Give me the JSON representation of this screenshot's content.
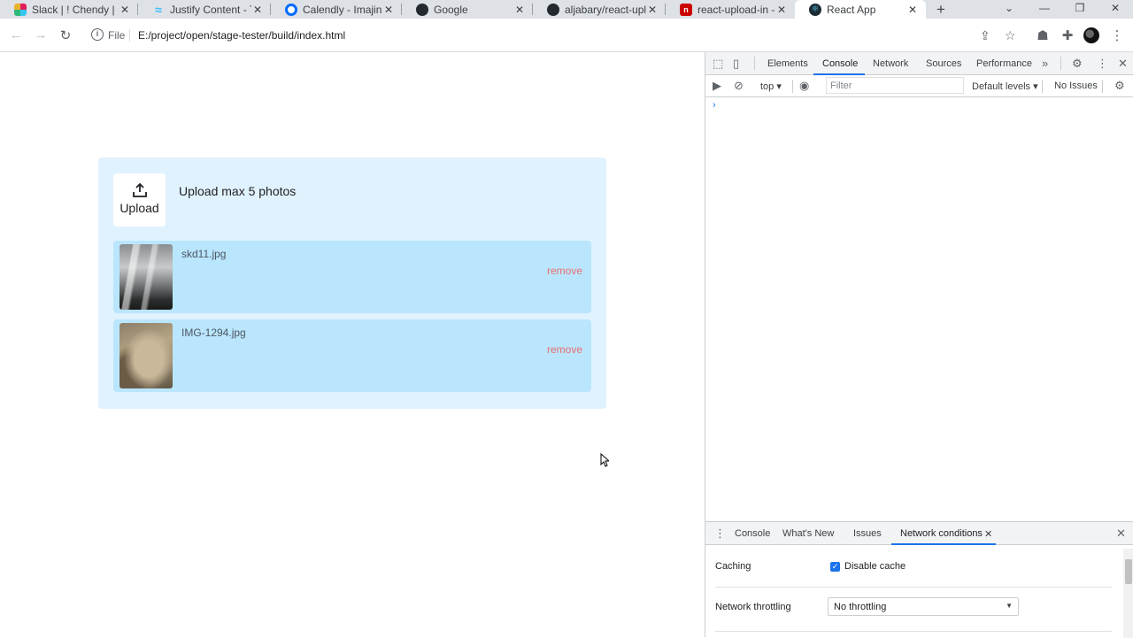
{
  "tabs": [
    {
      "title": "Slack | ! Chendy | Im",
      "icon": "slack-icon"
    },
    {
      "title": "Justify Content - Tail",
      "icon": "tailwind-icon"
    },
    {
      "title": "Calendly - Imajin HR",
      "icon": "calendly-icon"
    },
    {
      "title": "Google",
      "icon": "github-icon"
    },
    {
      "title": "aljabary/react-uploa",
      "icon": "github-icon"
    },
    {
      "title": "react-upload-in - np",
      "icon": "npm-icon"
    },
    {
      "title": "React App",
      "icon": "react-icon"
    }
  ],
  "toolbar": {
    "file_label": "File",
    "url": "E:/project/open/stage-tester/build/index.html"
  },
  "page": {
    "upload_label": "Upload",
    "upload_title": "Upload max 5 photos",
    "files": [
      {
        "name": "skd11.jpg",
        "remove_label": "remove"
      },
      {
        "name": "IMG-1294.jpg",
        "remove_label": "remove"
      }
    ]
  },
  "devtools": {
    "tabs": [
      "Elements",
      "Console",
      "Network",
      "Sources",
      "Performance"
    ],
    "active_tab": "Console",
    "context": "top",
    "filter_placeholder": "Filter",
    "levels": "Default levels",
    "issues": "No Issues",
    "drawer_tabs": [
      "Console",
      "What's New",
      "Issues",
      "Network conditions"
    ],
    "active_drawer_tab": "Network conditions",
    "network_conditions": {
      "caching_label": "Caching",
      "disable_cache_label": "Disable cache",
      "disable_cache_checked": true,
      "throttling_label": "Network throttling",
      "throttling_value": "No throttling"
    }
  },
  "colors": {
    "panel_bg": "#e0f2fe",
    "item_bg": "#bae6fd",
    "remove": "#e76f6f",
    "accent": "#1a73e8"
  }
}
